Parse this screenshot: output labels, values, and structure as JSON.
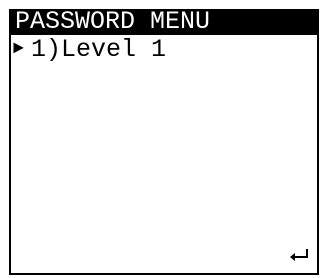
{
  "screen": {
    "title": "PASSWORD MENU",
    "menu_items": [
      {
        "pointer": "►",
        "label": "1)Level 1",
        "selected": true
      }
    ],
    "enter_icon": "enter-return-icon"
  },
  "colors": {
    "background": "#ffffff",
    "foreground": "#000000",
    "title_bar_bg": "#000000",
    "title_bar_fg": "#ffffff"
  }
}
